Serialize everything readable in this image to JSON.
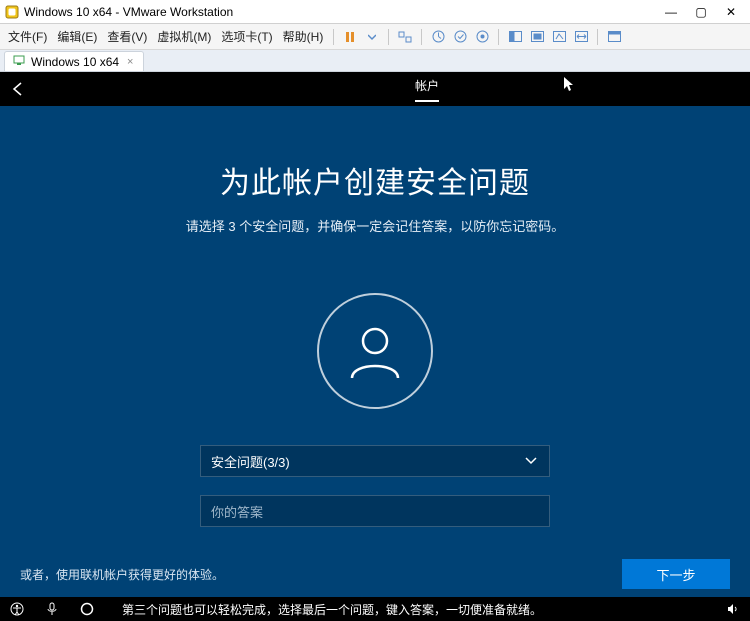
{
  "window": {
    "title": "Windows 10 x64 - VMware Workstation",
    "controls": {
      "minimize": "—",
      "maximize": "▢",
      "close": "✕"
    }
  },
  "menu": {
    "file": "文件(F)",
    "edit": "编辑(E)",
    "view": "查看(V)",
    "vm": "虚拟机(M)",
    "tabs": "选项卡(T)",
    "help": "帮助(H)"
  },
  "tab": {
    "label": "Windows 10 x64",
    "close": "×"
  },
  "oobe": {
    "tab_label": "帐户",
    "heading": "为此帐户创建安全问题",
    "subtitle": "请选择 3 个安全问题，并确保一定会记住答案，以防你忘记密码。",
    "select_label": "安全问题(3/3)",
    "answer_placeholder": "你的答案",
    "alt_link": "或者，使用联机帐户获得更好的体验。",
    "next": "下一步"
  },
  "osbar": {
    "caption": "第三个问题也可以轻松完成，选择最后一个问题，键入答案，一切便准备就绪。"
  }
}
